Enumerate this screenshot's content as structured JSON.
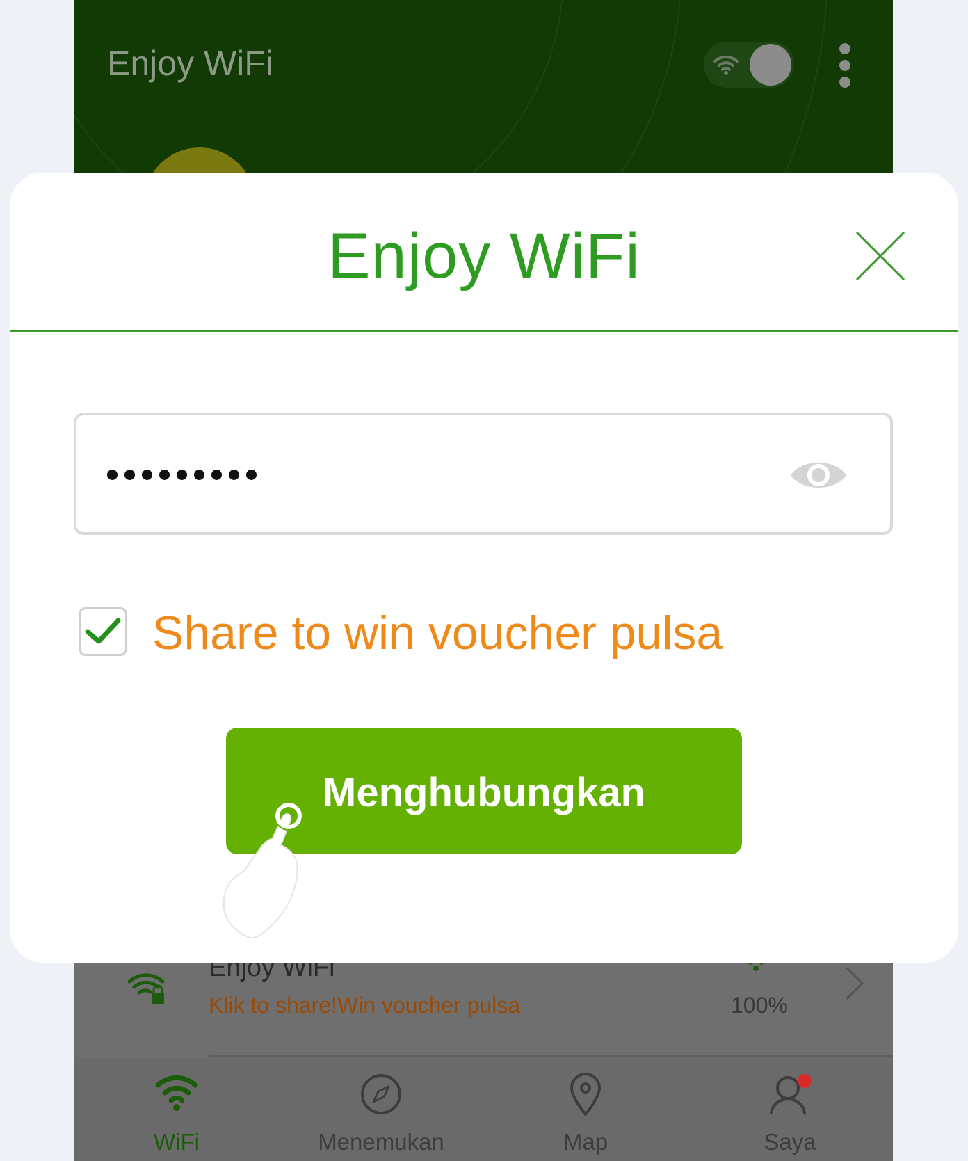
{
  "background_app": {
    "title": "Enjoy WiFi",
    "network": {
      "name": "Enjoy WiFi",
      "subtitle": "Klik to share!Win voucher pulsa",
      "signal": "100%"
    },
    "tabs": [
      {
        "label": "WiFi",
        "icon": "wifi-icon",
        "active": true
      },
      {
        "label": "Menemukan",
        "icon": "compass-icon",
        "active": false
      },
      {
        "label": "Map",
        "icon": "map-pin-icon",
        "active": false
      },
      {
        "label": "Saya",
        "icon": "user-icon",
        "active": false
      }
    ]
  },
  "dialog": {
    "title": "Enjoy WiFi",
    "password": {
      "masked_value": "••••••••",
      "dot_count": 9
    },
    "share_checkbox": {
      "checked": true,
      "label": "Share to win voucher pulsa"
    },
    "connect_button": "Menghubungkan"
  },
  "colors": {
    "brand_green": "#2e9b21",
    "button_green": "#64b103",
    "accent_orange": "#ef8a1a",
    "header_dark_green": "#123a04",
    "notification_red": "#d92a2a"
  }
}
